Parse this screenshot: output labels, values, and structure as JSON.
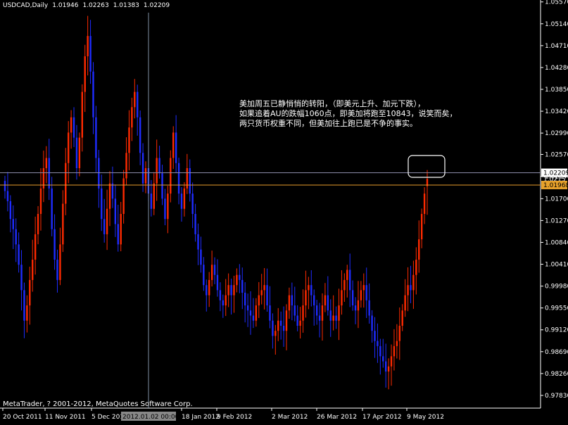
{
  "header": {
    "symbol": "USDCAD,Daily",
    "open": "1.01946",
    "high": "1.02263",
    "low": "1.01383",
    "close": "1.02209"
  },
  "annotation": [
    "美加周五已静悄悄的转阳，（即美元上升、加元下跌），",
    "如果追着AU的跌幅1060点，即美加将跑至10843，说笑而矣，",
    "两只货币权重不同，但美加往上跑已是不争的事实。"
  ],
  "copyright": "MetaTrader, ? 2001-2012, MetaQuotes Software Corp.",
  "colors": {
    "bull": "#ff2a00",
    "bear": "#1e2cff",
    "axis": "#ffffff",
    "bid_line": "#8c8ca8",
    "ask_line": "#e89b2b",
    "crosshair": "#7f8fa4",
    "highlight": "#ffffff"
  },
  "markers": {
    "bid_label": "1.02209",
    "bid_hidden_label": "1.0215",
    "ask_label": "1.01968",
    "crosshair_date": "2012.01.02 00:00"
  },
  "chart_data": {
    "type": "candlestick",
    "symbol": "USDCAD",
    "timeframe": "Daily",
    "ylim": [
      0.9758,
      1.0558
    ],
    "y_ticks": [
      "1.05570",
      "1.05140",
      "1.04710",
      "1.04280",
      "1.03850",
      "1.03420",
      "1.02990",
      "1.02570",
      "1.02140",
      "1.01700",
      "1.01270",
      "1.00840",
      "1.00410",
      "0.99980",
      "0.99550",
      "0.99120",
      "0.98690",
      "0.98260",
      "0.97830"
    ],
    "x_ticks": [
      "20 Oct 2011",
      "11 Nov 2011",
      "5 Dec 2011",
      "18 Jan 2012",
      "9 Feb 2012",
      "2 Mar 2012",
      "26 Mar 2012",
      "17 Apr 2012",
      "9 May 2012"
    ],
    "last_bar": {
      "open": 1.01946,
      "high": 1.02263,
      "low": 1.01383,
      "close": 1.02209
    },
    "closes": [
      1.0185,
      1.0165,
      1.013,
      1.011,
      1.008,
      1.004,
      0.999,
      0.993,
      0.996,
      1.001,
      1.005,
      1.01,
      1.014,
      1.019,
      1.023,
      1.025,
      1.019,
      1.011,
      1.005,
      1.001,
      1.008,
      1.016,
      1.024,
      1.03,
      1.033,
      1.029,
      1.023,
      1.029,
      1.038,
      1.045,
      1.049,
      1.042,
      1.033,
      1.025,
      1.019,
      1.013,
      1.01,
      1.015,
      1.02,
      1.017,
      1.012,
      1.008,
      1.014,
      1.021,
      1.026,
      1.031,
      1.035,
      1.038,
      1.033,
      1.026,
      1.02,
      1.023,
      1.018,
      1.015,
      1.02,
      1.025,
      1.022,
      1.017,
      1.013,
      1.018,
      1.025,
      1.03,
      1.024,
      1.018,
      1.015,
      1.019,
      1.023,
      1.018,
      1.014,
      1.01,
      1.007,
      1.004,
      1.0,
      0.998,
      1.001,
      1.004,
      1.002,
      0.999,
      0.997,
      0.996,
      0.998,
      1.0,
      0.998,
      1.0,
      1.002,
      1.001,
      0.9985,
      0.996,
      0.995,
      0.994,
      0.993,
      0.996,
      0.998,
      0.999,
      1.0,
      0.996,
      0.993,
      0.99,
      0.991,
      0.993,
      0.992,
      0.991,
      0.995,
      0.998,
      0.996,
      0.994,
      0.992,
      0.993,
      0.996,
      0.999,
      1.0,
      0.998,
      0.996,
      0.994,
      0.993,
      0.996,
      0.998,
      0.995,
      0.993,
      0.994,
      0.993,
      0.996,
      0.999,
      1.001,
      1.003,
      0.999,
      0.996,
      0.995,
      0.997,
      0.999,
      1.0,
      0.997,
      0.994,
      0.991,
      0.989,
      0.988,
      0.986,
      0.985,
      0.983,
      0.984,
      0.986,
      0.988,
      0.989,
      0.992,
      0.995,
      0.998,
      1.0,
      0.999,
      1.002,
      1.005,
      1.009,
      1.014,
      1.018,
      1.0209
    ]
  }
}
